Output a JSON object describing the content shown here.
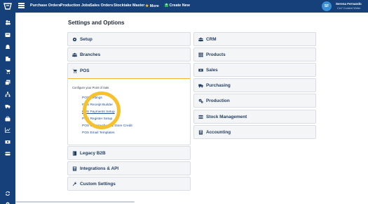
{
  "topbar": {
    "nav": [
      {
        "label": "Purchase Orders"
      },
      {
        "label": "Production Jobs"
      },
      {
        "label": "Sales Orders"
      },
      {
        "label": "Stocktake Master"
      },
      {
        "label": "More"
      },
      {
        "label": "Create New"
      }
    ],
    "user": {
      "initials": "SF",
      "name": "Serena Fernando",
      "role": "Cin7 Content Writer"
    }
  },
  "sidebar": {
    "icons": [
      "users-icon",
      "inbox-icon",
      "bell-icon",
      "building-icon",
      "cart-icon",
      "layers-icon",
      "hierarchy-icon",
      "truck-icon",
      "briefcase-icon",
      "chart-icon",
      "cash-icon",
      "card-icon",
      "sync-icon",
      "gear-icon"
    ]
  },
  "page": {
    "title": "Settings and Options"
  },
  "left_cards": {
    "setup": "Setup",
    "branches": "Branches",
    "pos": "POS",
    "legacy": "Legacy B2B",
    "integrations": "Integrations & API",
    "custom": "Custom Settings"
  },
  "pos_panel": {
    "description": "Configure your Point of Sale.",
    "links": [
      "POS Settings",
      "POS Receipt Builder",
      "POS Payments Setup",
      "POS Register Setup",
      "POS Gift Vouchers & Store Credit",
      "POS Email Templates"
    ],
    "active_index": 2
  },
  "right_cards": {
    "crm": "CRM",
    "products": "Products",
    "sales": "Sales",
    "purchasing": "Purchasing",
    "production": "Production",
    "stock": "Stock Management",
    "accounting": "Accounting"
  },
  "colors": {
    "navy": "#16407a",
    "highlight": "#f5c12c",
    "link": "#1d4f91"
  }
}
